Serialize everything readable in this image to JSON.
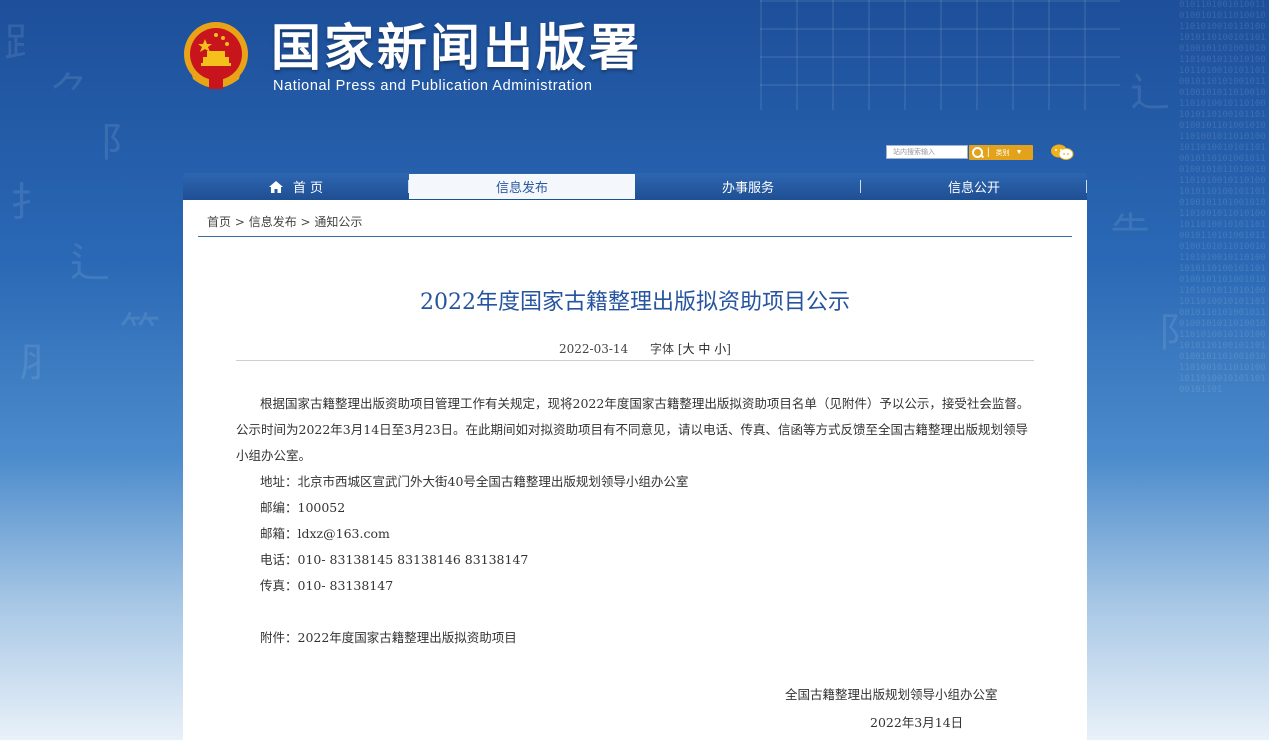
{
  "header": {
    "org_name_cn": "国家新闻出版署",
    "org_name_en": "National Press and Publication Administration"
  },
  "search": {
    "placeholder": "站内搜索输入",
    "category": "类别"
  },
  "nav": {
    "items": [
      {
        "label": "首 页"
      },
      {
        "label": "信息发布"
      },
      {
        "label": "办事服务"
      },
      {
        "label": "信息公开"
      }
    ]
  },
  "breadcrumb": {
    "home": "首页",
    "sep1": " > ",
    "level1": "信息发布",
    "sep2": " > ",
    "level2": "通知公示"
  },
  "article": {
    "title": "2022年度国家古籍整理出版拟资助项目公示",
    "date": "2022-03-14",
    "font_size_label": "字体 [",
    "font_large": "大",
    "font_medium": "中",
    "font_small": "小",
    "font_size_end": "]",
    "paragraph": "根据国家古籍整理出版资助项目管理工作有关规定，现将2022年度国家古籍整理出版拟资助项目名单（见附件）予以公示，接受社会监督。公示时间为2022年3月14日至3月23日。在此期间如对拟资助项目有不同意见，请以电话、传真、信函等方式反馈至全国古籍整理出版规划领导小组办公室。",
    "address": "地址：北京市西城区宣武门外大街40号全国古籍整理出版规划领导小组办公室",
    "postcode": "邮编：100052",
    "email": "邮箱：ldxz@163.com",
    "phone": "电话：010-  83138145  83138146  83138147",
    "fax": "传真：010-  83138147",
    "attachment": "附件：2022年度国家古籍整理出版拟资助项目",
    "signature": "全国古籍整理出版规划领导小组办公室",
    "sign_date": "2022年3月14日"
  }
}
